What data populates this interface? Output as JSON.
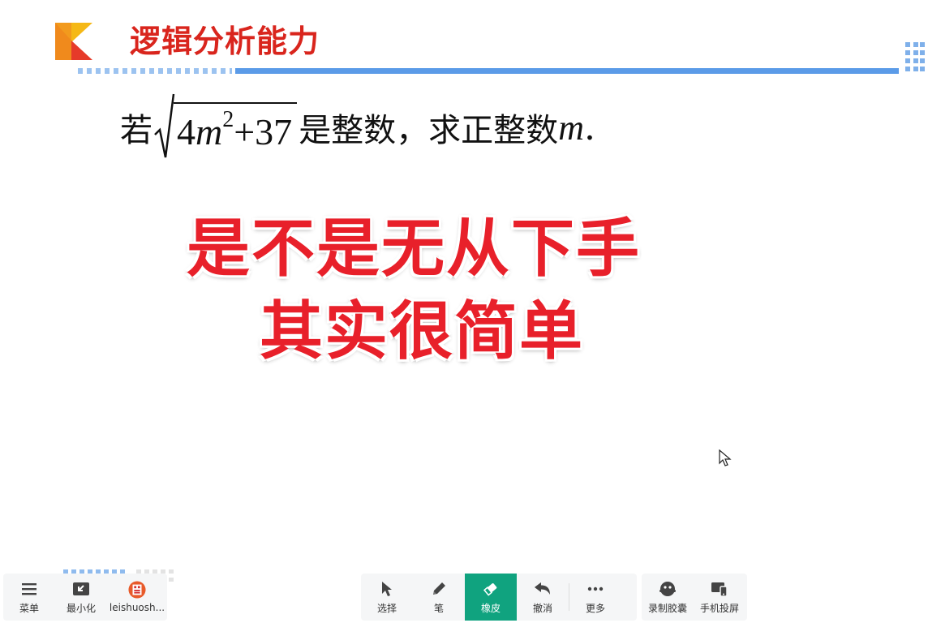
{
  "slide": {
    "title": "逻辑分析能力",
    "problem": {
      "prefix": "若",
      "radicand_coef": "4",
      "radicand_var": "m",
      "radicand_exp": "2",
      "radicand_rest": "+37",
      "suffix": "是整数，求正整数",
      "end_var": "m",
      "end_punct": "."
    },
    "overlay_line1": "是不是无从下手",
    "overlay_line2": "其实很简单"
  },
  "toolbar_left": [
    {
      "label": "菜单",
      "icon": "menu-icon"
    },
    {
      "label": "最小化",
      "icon": "minimize-icon"
    },
    {
      "label": "leishuosh...",
      "icon": "avatar"
    }
  ],
  "toolbar_mid": [
    {
      "label": "选择",
      "icon": "cursor-icon"
    },
    {
      "label": "笔",
      "icon": "pen-icon"
    },
    {
      "label": "橡皮",
      "icon": "eraser-icon",
      "active": true
    },
    {
      "label": "撤消",
      "icon": "undo-icon"
    },
    {
      "label": "更多",
      "icon": "more-icon"
    }
  ],
  "toolbar_right": [
    {
      "label": "录制胶囊",
      "icon": "record-icon"
    },
    {
      "label": "手机投屏",
      "icon": "screen-cast-icon"
    }
  ],
  "colors": {
    "title_red": "#d9251d",
    "overlay_red": "#e8202a",
    "accent_blue": "#5b9be8",
    "active_green": "#10a37f"
  }
}
